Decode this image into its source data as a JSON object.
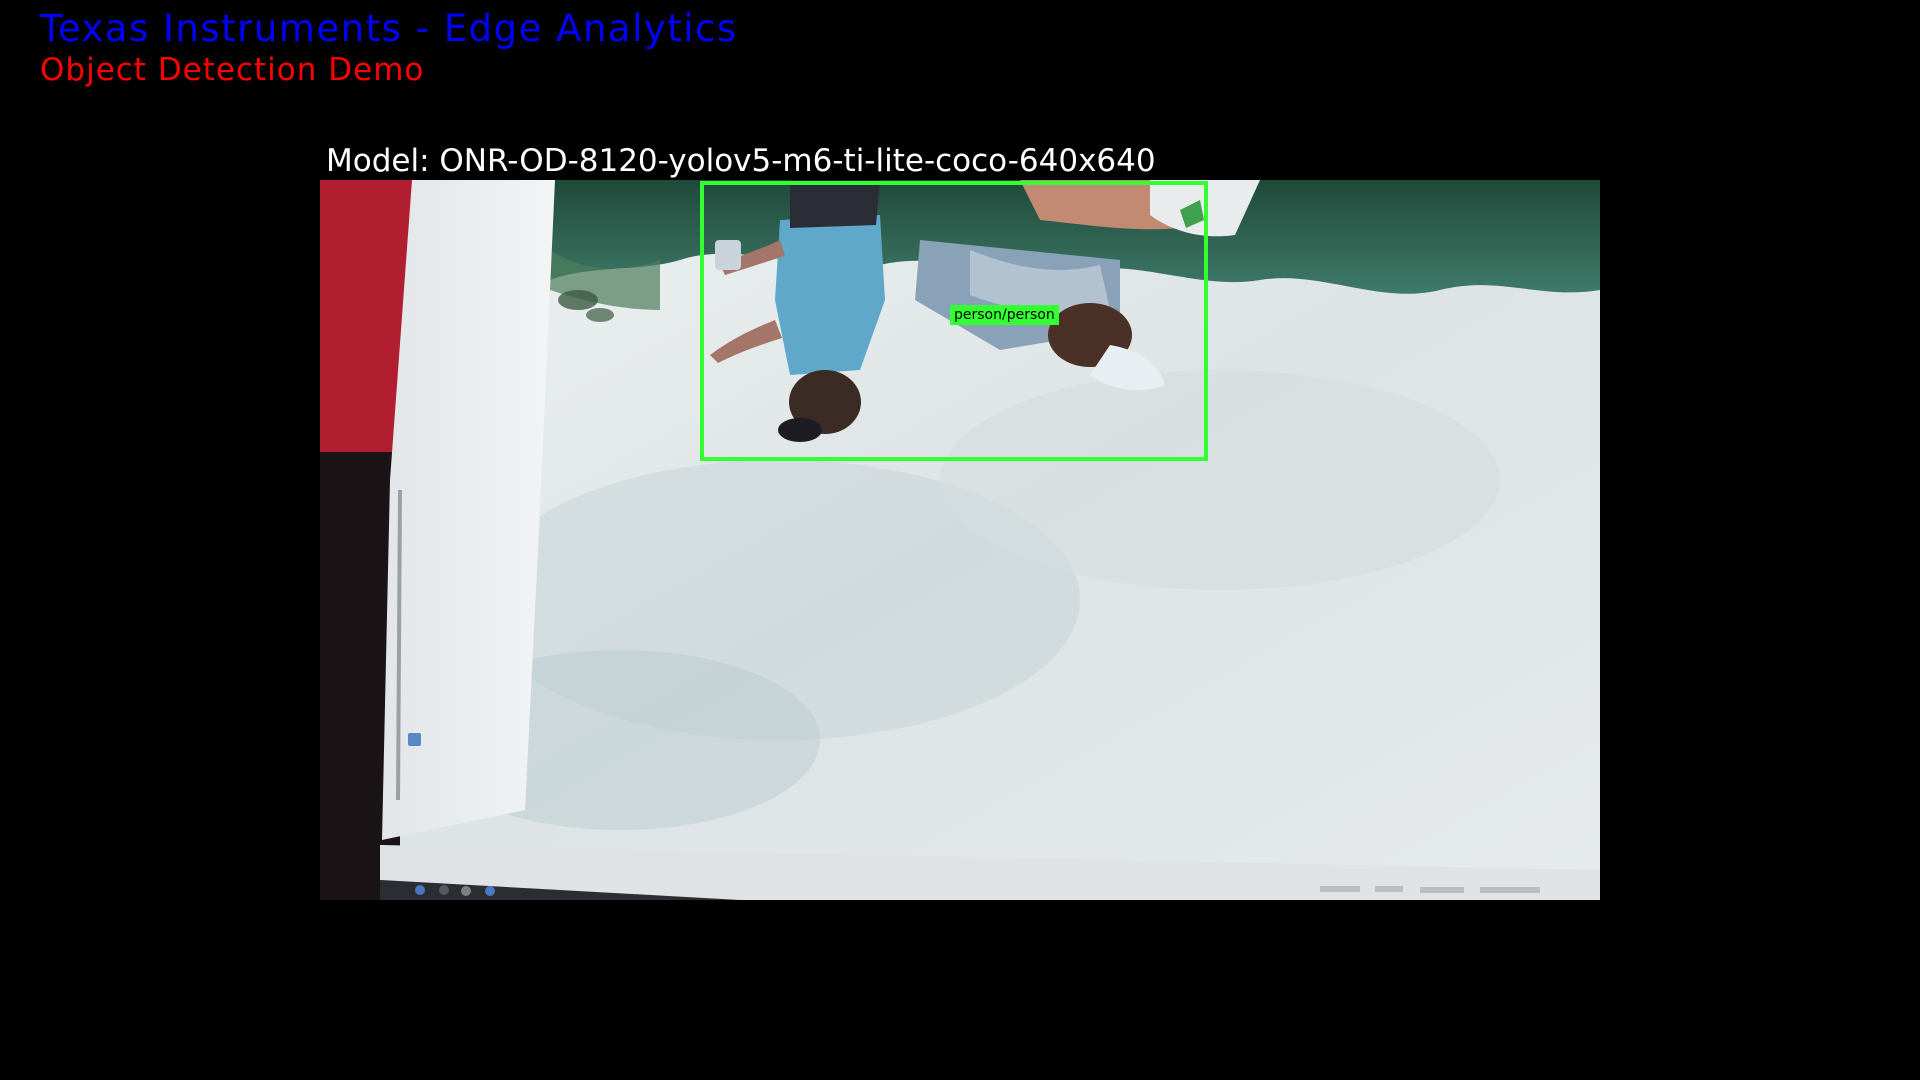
{
  "header": {
    "title": "Texas Instruments - Edge Analytics",
    "subtitle": "Object Detection Demo",
    "title_color": "#0000ff",
    "subtitle_color": "#ff0000"
  },
  "model": {
    "label": "Model: ONR-OD-8120-yolov5-m6-ti-lite-coco-640x640"
  },
  "detections": [
    {
      "label": "person/person",
      "color": "#33ff33"
    }
  ]
}
